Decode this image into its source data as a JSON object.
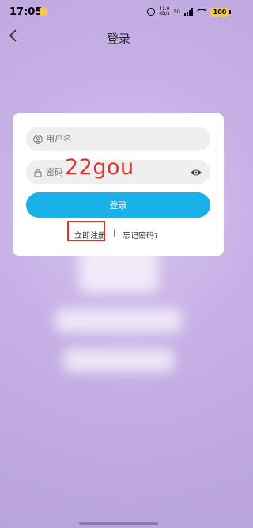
{
  "status_bar": {
    "time": "17:05",
    "net_speed_value": "41.9",
    "net_speed_unit": "KB/s",
    "network": "5G",
    "battery": "100"
  },
  "nav": {
    "title": "登录",
    "back_icon": "chevron-left-icon"
  },
  "form": {
    "username_placeholder": "用户名",
    "password_placeholder": "密码",
    "login_label": "登录",
    "register_label": "立即注册",
    "separator": "|",
    "forgot_label": "忘记密码?"
  },
  "overlay": {
    "watermark": "22gou"
  },
  "colors": {
    "accent": "#1ab0e8",
    "annotation": "#e0332e",
    "battery": "#f2c94c"
  }
}
